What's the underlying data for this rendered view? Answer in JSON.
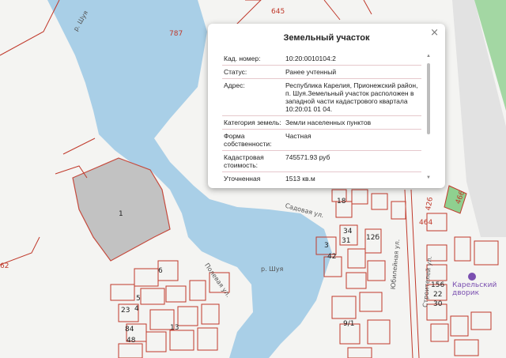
{
  "map": {
    "water_color": "#a9cfe7",
    "parcel_color": "#c0392b",
    "road_labels": {
      "river_top": "р. Шуя",
      "river_bottom": "р. Шуя",
      "polevaya": "Полевая ул.",
      "sadovaya": "Садовая ул.",
      "yubileynaya": "Юбилейная ул.",
      "stroiteley": "Строителей ул."
    },
    "numbers": {
      "n645": "645",
      "n787": "787",
      "n62": "62",
      "n466": "466",
      "n426": "426",
      "n464": "464",
      "n18": "18",
      "n34": "34",
      "n12b": "12б",
      "n31": "31",
      "n42": "42",
      "n3": "3",
      "n156": "156",
      "n22": "22",
      "n30": "30",
      "n13": "13",
      "n9_1": "9/1",
      "n23": "23",
      "n84": "84",
      "n48": "48",
      "n6": "6",
      "n1": "1",
      "n5": "5",
      "n4": "4"
    },
    "poi": {
      "line1": "Карельский",
      "line2": "дворик"
    },
    "accent": "#7a4fb0"
  },
  "popup": {
    "title": "Земельный участок",
    "close": "×",
    "rows": [
      {
        "key": "Кад. номер:",
        "value": "10:20:0010104:2"
      },
      {
        "key": "Статус:",
        "value": "Ранее учтенный"
      },
      {
        "key": "Адрес:",
        "value": "Республика Карелия, Прионежский район, п. Шуя.Земельный участок расположен в западной части кадастрового квартала 10:20:01 01 04."
      },
      {
        "key": "Категория земель:",
        "value": "Земли населенных пунктов"
      },
      {
        "key": "Форма собственности:",
        "value": "Частная"
      },
      {
        "key": "Кадастровая стоимость:",
        "value": "745571.93 руб"
      },
      {
        "key": "Уточненная площадь:",
        "value": "1513 кв.м"
      }
    ]
  }
}
